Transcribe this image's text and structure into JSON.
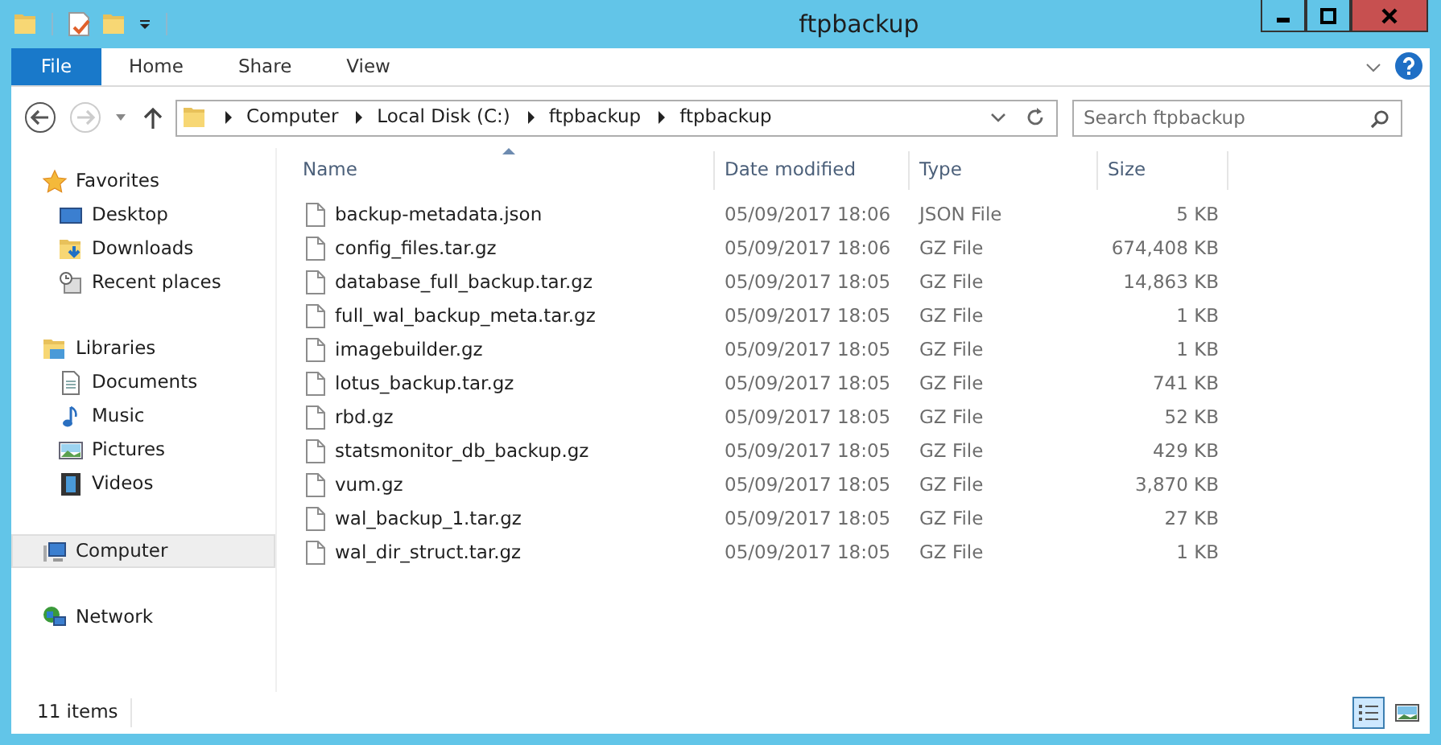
{
  "window": {
    "title": "ftpbackup"
  },
  "ribbon": {
    "tabs": [
      {
        "label": "File",
        "kind": "file",
        "selected": false
      },
      {
        "label": "Home",
        "kind": "tab",
        "selected": false
      },
      {
        "label": "Share",
        "kind": "tab",
        "selected": false
      },
      {
        "label": "View",
        "kind": "tab",
        "selected": false
      }
    ]
  },
  "address": {
    "crumbs": [
      "Computer",
      "Local Disk (C:)",
      "ftpbackup",
      "ftpbackup"
    ]
  },
  "search": {
    "placeholder": "Search ftpbackup"
  },
  "navigation": [
    {
      "label": "Favorites",
      "kind": "star",
      "selected": false,
      "children": [
        {
          "label": "Desktop",
          "kind": "desktop",
          "selected": false
        },
        {
          "label": "Downloads",
          "kind": "downloads",
          "selected": false
        },
        {
          "label": "Recent places",
          "kind": "recent",
          "selected": false
        }
      ]
    },
    {
      "label": "Libraries",
      "kind": "library",
      "selected": false,
      "children": [
        {
          "label": "Documents",
          "kind": "document",
          "selected": false
        },
        {
          "label": "Music",
          "kind": "music",
          "selected": false
        },
        {
          "label": "Pictures",
          "kind": "pictures",
          "selected": false
        },
        {
          "label": "Videos",
          "kind": "videos",
          "selected": false
        }
      ]
    },
    {
      "label": "Computer",
      "kind": "computer",
      "selected": true
    },
    {
      "label": "Network",
      "kind": "network",
      "selected": false
    }
  ],
  "table": {
    "columns": [
      {
        "label": "Name",
        "sorted": true
      },
      {
        "label": "Date modified",
        "sorted": false
      },
      {
        "label": "Type",
        "sorted": false
      },
      {
        "label": "Size",
        "sorted": false
      }
    ],
    "rows": [
      [
        "backup-metadata.json",
        "05/09/2017 18:06",
        "JSON File",
        "5 KB"
      ],
      [
        "config_files.tar.gz",
        "05/09/2017 18:06",
        "GZ File",
        "674,408 KB"
      ],
      [
        "database_full_backup.tar.gz",
        "05/09/2017 18:05",
        "GZ File",
        "14,863 KB"
      ],
      [
        "full_wal_backup_meta.tar.gz",
        "05/09/2017 18:05",
        "GZ File",
        "1 KB"
      ],
      [
        "imagebuilder.gz",
        "05/09/2017 18:05",
        "GZ File",
        "1 KB"
      ],
      [
        "lotus_backup.tar.gz",
        "05/09/2017 18:05",
        "GZ File",
        "741 KB"
      ],
      [
        "rbd.gz",
        "05/09/2017 18:05",
        "GZ File",
        "52 KB"
      ],
      [
        "statsmonitor_db_backup.gz",
        "05/09/2017 18:05",
        "GZ File",
        "429 KB"
      ],
      [
        "vum.gz",
        "05/09/2017 18:05",
        "GZ File",
        "3,870 KB"
      ],
      [
        "wal_backup_1.tar.gz",
        "05/09/2017 18:05",
        "GZ File",
        "27 KB"
      ],
      [
        "wal_dir_struct.tar.gz",
        "05/09/2017 18:05",
        "GZ File",
        "1 KB"
      ]
    ]
  },
  "status_bar": {
    "item_count": "11 items"
  },
  "views": [
    {
      "kind": "details",
      "selected": true
    },
    {
      "kind": "tiles",
      "selected": false
    }
  ]
}
